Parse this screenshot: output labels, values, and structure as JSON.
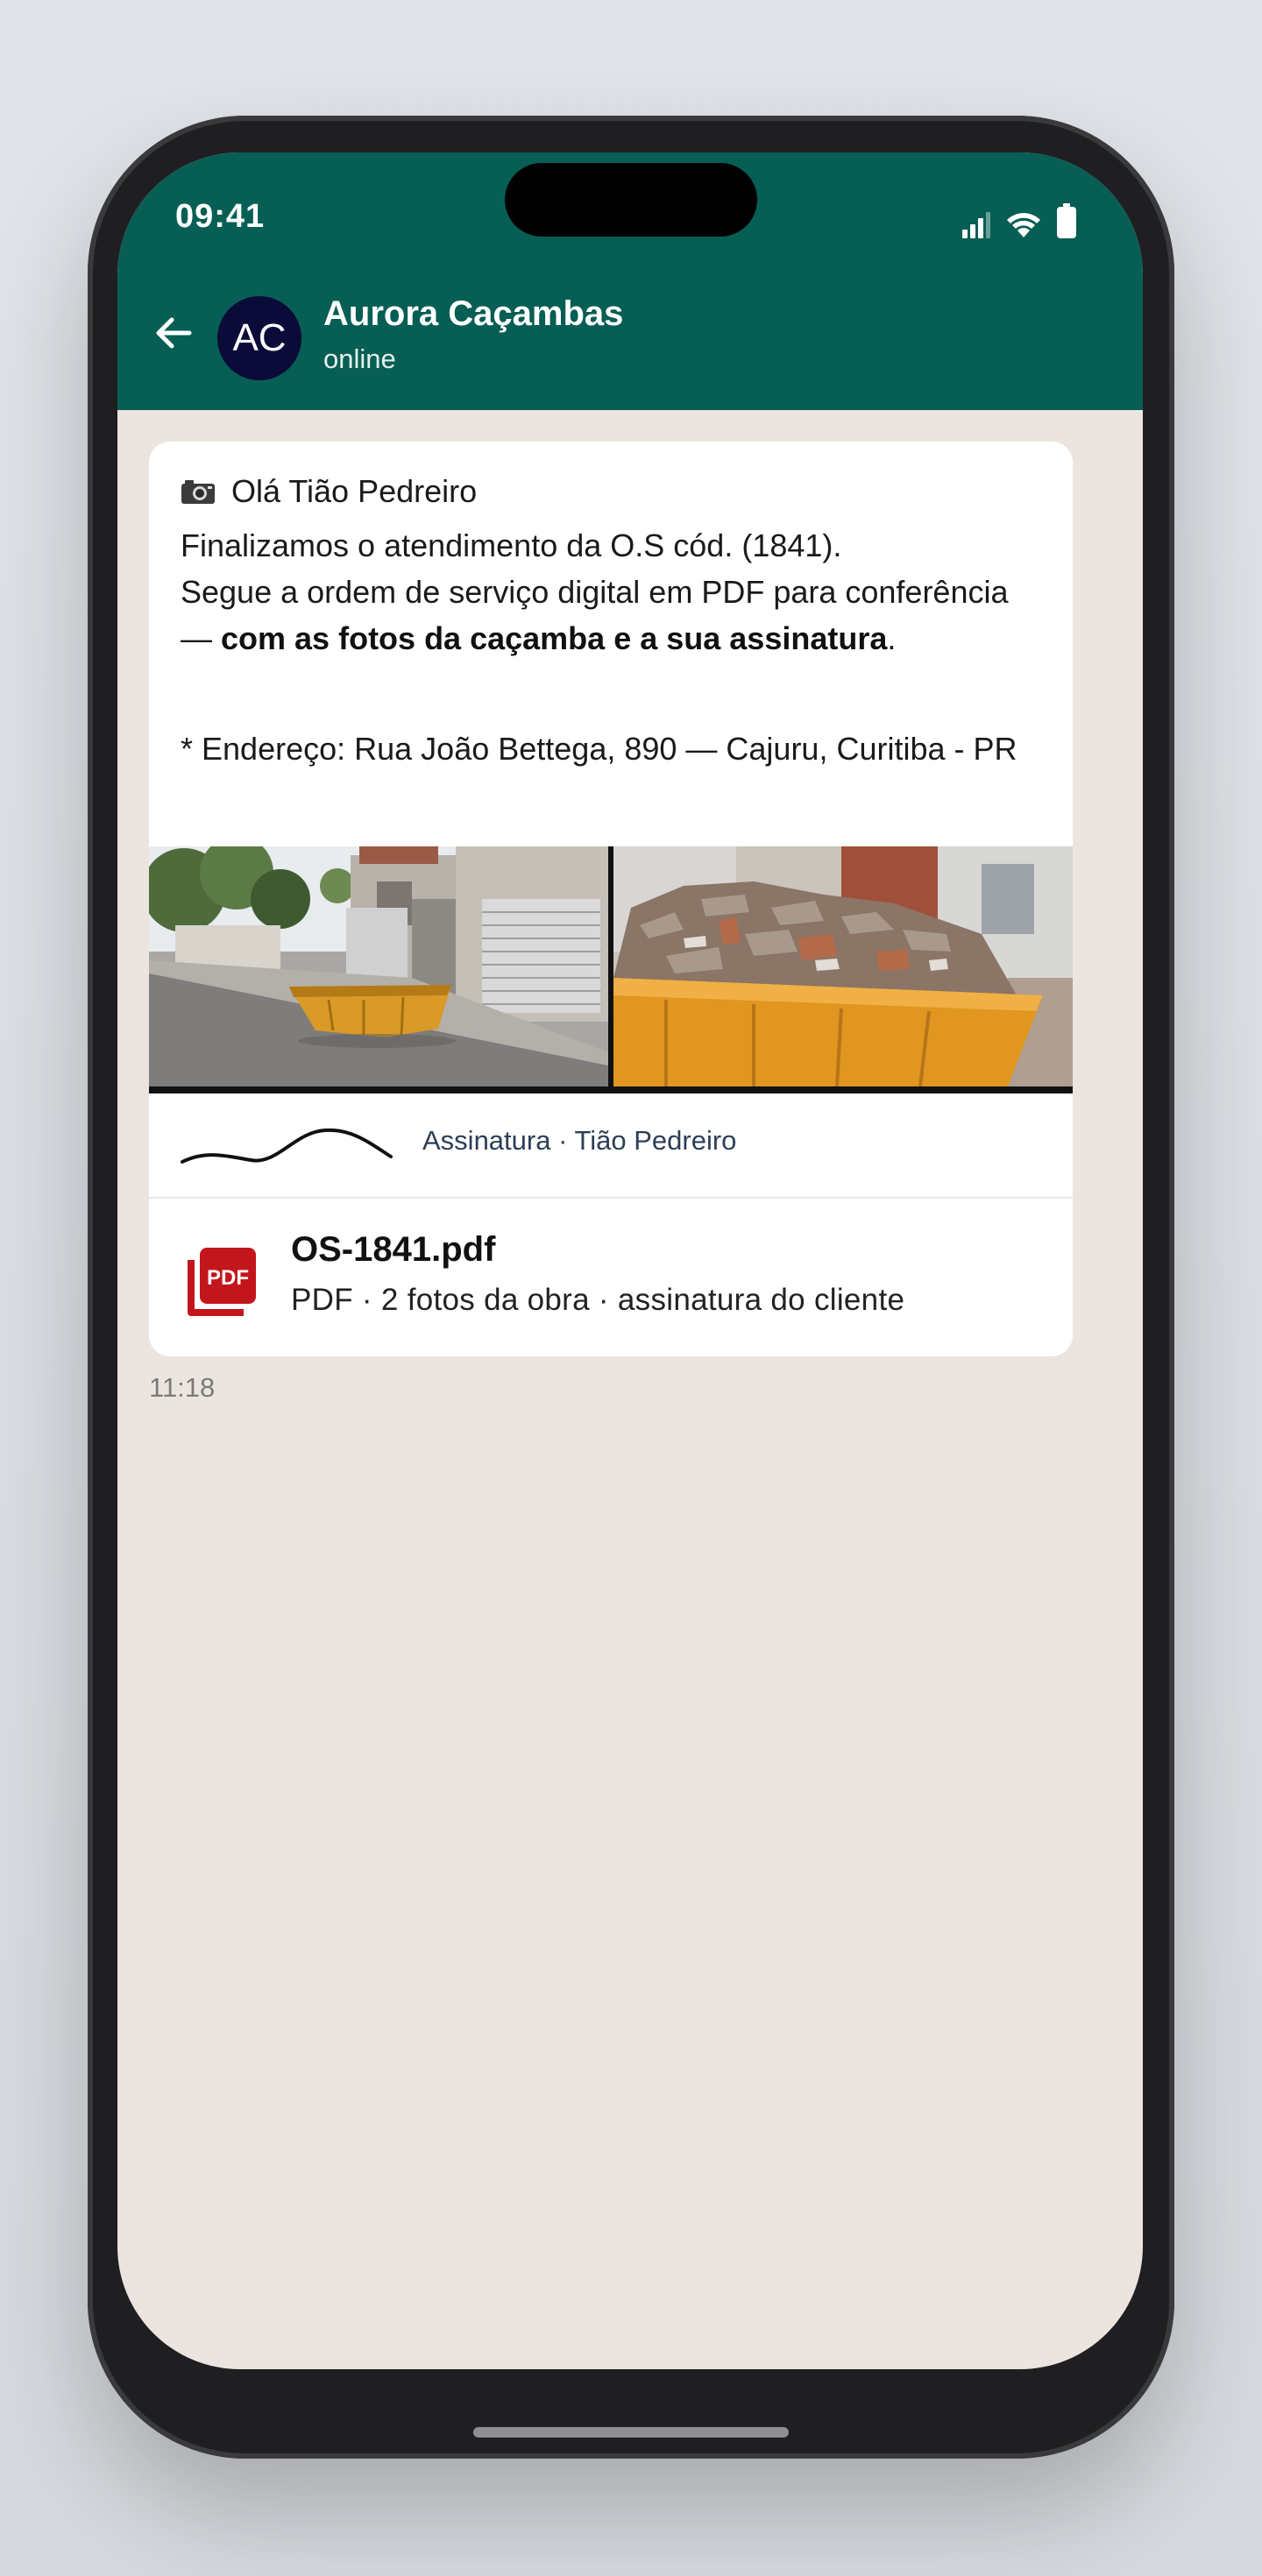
{
  "status_bar": {
    "time": "09:41"
  },
  "chat_header": {
    "avatar_initials": "AC",
    "contact_name": "Aurora Caçambas",
    "contact_status": "online"
  },
  "message": {
    "greeting_icon": "camera-icon",
    "greeting": "Olá Tião Pedreiro",
    "line1": "Finalizamos o atendimento da O.S cód. (1841).",
    "line2_start": "Segue a ordem de serviço digital em PDF para conferência — ",
    "line2_bold": "com as fotos da caçamba e a sua assinatura",
    "line2_end": ".",
    "address": "* Endereço: Rua João Bettega, 890 — Cajuru, Curitiba - PR",
    "signature_label": "Assinatura · Tião Pedreiro",
    "attachment": {
      "icon": "pdf-icon",
      "file_name": "OS-1841.pdf",
      "file_meta": "PDF · 2 fotos da obra · assinatura do cliente"
    },
    "time": "11:18"
  },
  "colors": {
    "header": "#075e54",
    "chat_background": "#ece5df",
    "bubble": "#ffffff",
    "pdf_red": "#c3161c"
  }
}
